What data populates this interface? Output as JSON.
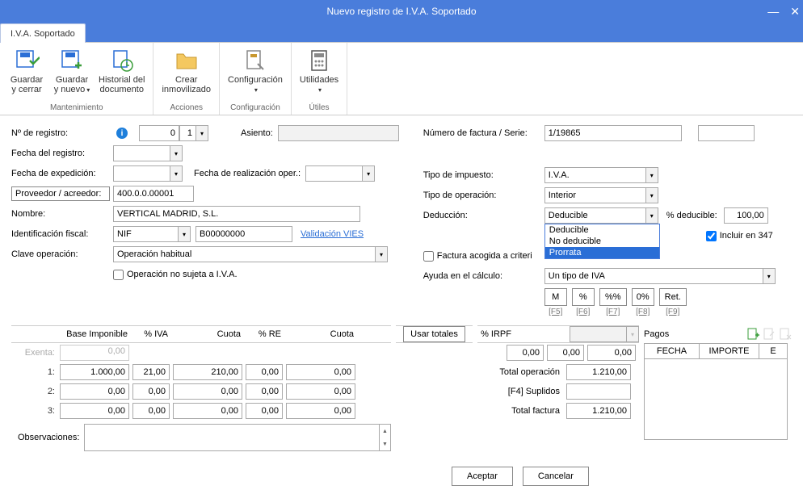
{
  "window": {
    "title": "Nuevo registro de I.V.A. Soportado"
  },
  "tab": "I.V.A. Soportado",
  "ribbon": {
    "groups": [
      {
        "label": "Mantenimiento",
        "items": [
          {
            "label": "Guardar\ny cerrar"
          },
          {
            "label": "Guardar\ny nuevo",
            "drop": "▾"
          },
          {
            "label": "Historial del\ndocumento"
          }
        ]
      },
      {
        "label": "Acciones",
        "items": [
          {
            "label": "Crear\ninmovilizado"
          }
        ]
      },
      {
        "label": "Configuración",
        "items": [
          {
            "label": "Configuración",
            "drop": "▾"
          }
        ]
      },
      {
        "label": "Útiles",
        "items": [
          {
            "label": "Utilidades",
            "drop": "▾"
          }
        ]
      }
    ]
  },
  "left": {
    "n_registro_label": "Nº de registro:",
    "n_registro_a": "0",
    "n_registro_b": "1",
    "asiento_label": "Asiento:",
    "fecha_registro_label": "Fecha del registro:",
    "fecha_exp_label": "Fecha de expedición:",
    "fecha_real_label": "Fecha de realización oper.:",
    "proveedor_label": "Proveedor / acreedor:",
    "proveedor_val": "400.0.0.00001",
    "nombre_label": "Nombre:",
    "nombre_val": "VERTICAL MADRID, S.L.",
    "idfiscal_label": "Identificación fiscal:",
    "idfiscal_tipo": "NIF",
    "idfiscal_num": "B00000000",
    "vies": "Validación VIES",
    "clave_label": "Clave operación:",
    "clave_val": "Operación habitual",
    "op_no_sujeta": "Operación no sujeta a I.V.A."
  },
  "right": {
    "num_factura_label": "Número de factura / Serie:",
    "num_factura_val": "1/19865",
    "tipo_imp_label": "Tipo de impuesto:",
    "tipo_imp_val": "I.V.A.",
    "tipo_op_label": "Tipo de operación:",
    "tipo_op_val": "Interior",
    "ded_label": "Deducción:",
    "ded_val": "Deducible",
    "ded_opts": [
      "Deducible",
      "No deducible",
      "Prorrata"
    ],
    "pct_ded_label": "% deducible:",
    "pct_ded_val": "100,00",
    "incluir_347": "Incluir en 347",
    "factura_criterio": "Factura acogida a criteri",
    "ayuda_label": "Ayuda en el cálculo:",
    "ayuda_val": "Un tipo de IVA",
    "calc": [
      "M",
      "%",
      "%%",
      "0%",
      "Ret."
    ],
    "calc_hint": [
      "[F5]",
      "[F6]",
      "[F7]",
      "[F8]",
      "[F9]"
    ]
  },
  "grid": {
    "headers": {
      "base": "Base Imponible",
      "iva": "% IVA",
      "cuota": "Cuota",
      "re": "% RE",
      "cuota2": "Cuota",
      "usar": "Usar totales",
      "irpf": "% IRPF"
    },
    "rows": {
      "exenta": {
        "label": "Exenta:",
        "base": "0,00"
      },
      "r1": {
        "label": "1:",
        "base": "1.000,00",
        "iva": "21,00",
        "cuota": "210,00",
        "re": "0,00",
        "cuota2": "0,00"
      },
      "r2": {
        "label": "2:",
        "base": "0,00",
        "iva": "0,00",
        "cuota": "0,00",
        "re": "0,00",
        "cuota2": "0,00"
      },
      "r3": {
        "label": "3:",
        "base": "0,00",
        "iva": "0,00",
        "cuota": "0,00",
        "re": "0,00",
        "cuota2": "0,00"
      }
    },
    "irpf_vals": {
      "a": "0,00",
      "b": "0,00",
      "c": "0,00"
    },
    "totals": {
      "op_label": "Total operación",
      "op_val": "1.210,00",
      "sup_label": "[F4] Suplidos",
      "sup_val": "",
      "fac_label": "Total factura",
      "fac_val": "1.210,00"
    },
    "pagos_label": "Pagos",
    "pagos_head": {
      "fecha": "FECHA",
      "importe": "IMPORTE",
      "e": "E"
    },
    "obs_label": "Observaciones:"
  },
  "buttons": {
    "aceptar": "Aceptar",
    "cancelar": "Cancelar"
  }
}
